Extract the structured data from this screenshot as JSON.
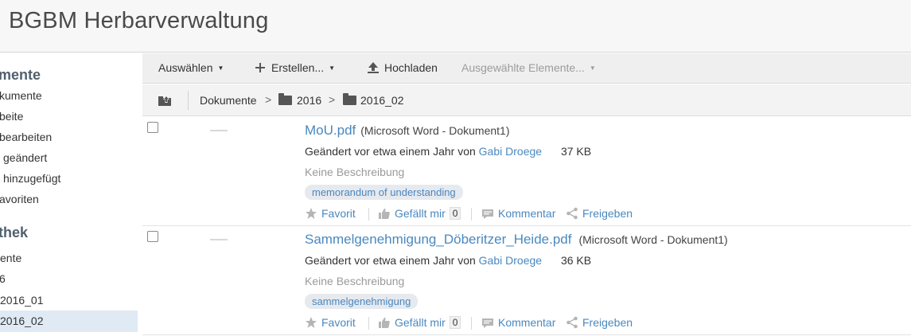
{
  "header": {
    "title": "BGBM Herbarverwaltung"
  },
  "sidebar": {
    "section1_title": "mente",
    "section1_items": [
      {
        "label": "kumente"
      },
      {
        "label": "beite"
      },
      {
        "label": "bearbeiten"
      },
      {
        "label": "geändert"
      },
      {
        "label": "hinzugefügt"
      },
      {
        "label": "avoriten"
      }
    ],
    "section2_title": "thek",
    "section2_items": [
      {
        "label": "ente"
      },
      {
        "label": "6"
      },
      {
        "label": "2016_01"
      },
      {
        "label": "2016_02",
        "selected": true
      }
    ]
  },
  "toolbar": {
    "select_label": "Auswählen",
    "create_label": "Erstellen...",
    "upload_label": "Hochladen",
    "selected_items_label": "Ausgewählte Elemente..."
  },
  "breadcrumb": {
    "items": [
      "Dokumente",
      "2016",
      "2016_02"
    ],
    "separator": ">"
  },
  "documents": [
    {
      "name": "MoU.pdf",
      "type": "(Microsoft Word - Dokument1)",
      "modified_prefix": "Geändert vor etwa einem Jahr von",
      "user": "Gabi Droege",
      "size": "37 KB",
      "description": "Keine Beschreibung",
      "tag": "memorandum of understanding",
      "favorite_label": "Favorit",
      "like_label": "Gefällt mir",
      "like_count": "0",
      "comment_label": "Kommentar",
      "share_label": "Freigeben"
    },
    {
      "name": "Sammelgenehmigung_Döberitzer_Heide.pdf",
      "type": "(Microsoft Word - Dokument1)",
      "modified_prefix": "Geändert vor etwa einem Jahr von",
      "user": "Gabi Droege",
      "size": "36 KB",
      "description": "Keine Beschreibung",
      "tag": "sammelgenehmigung",
      "favorite_label": "Favorit",
      "like_label": "Gefällt mir",
      "like_count": "0",
      "comment_label": "Kommentar",
      "share_label": "Freigeben"
    }
  ],
  "colors": {
    "link": "#4a88c0",
    "selected_bg": "#dfeaf5",
    "toolbar_bg": "#efefef"
  }
}
